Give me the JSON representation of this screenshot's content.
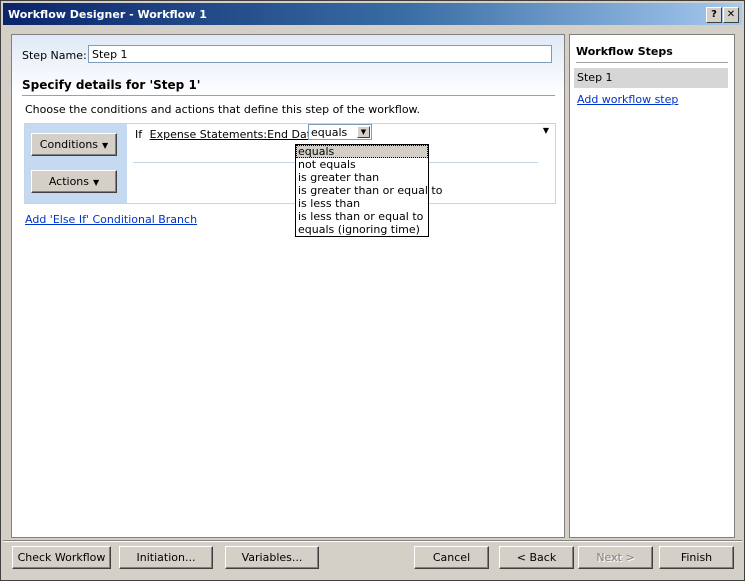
{
  "window": {
    "title": "Workflow Designer - Workflow 1",
    "help_glyph": "?",
    "close_glyph": "✕"
  },
  "main": {
    "step_name_label": "Step Name:",
    "step_name_value": "Step 1",
    "section_heading": "Specify details for 'Step 1'",
    "instructions": "Choose the conditions and actions that define this step of the workflow.",
    "conditions_button": "Conditions",
    "actions_button": "Actions",
    "condition": {
      "if_label": "If",
      "field": "Expense Statements:End Date",
      "operator_selected": "equals",
      "operator_options": [
        "equals",
        "not equals",
        "is greater than",
        "is greater than or equal to",
        "is less than",
        "is less than or equal to",
        "equals (ignoring time)"
      ]
    },
    "add_else_link": "Add 'Else If' Conditional Branch"
  },
  "sidebar": {
    "title": "Workflow Steps",
    "steps": [
      "Step 1"
    ],
    "add_link": "Add workflow step"
  },
  "footer": {
    "check_workflow": "Check Workflow",
    "initiation": "Initiation...",
    "variables": "Variables...",
    "cancel": "Cancel",
    "back": "< Back",
    "next": "Next >",
    "finish": "Finish"
  },
  "colors": {
    "titlebar_start": "#0a246a",
    "titlebar_end": "#a6caf0",
    "link": "#0033cc",
    "rule_left_bg": "#c5d9f1"
  }
}
